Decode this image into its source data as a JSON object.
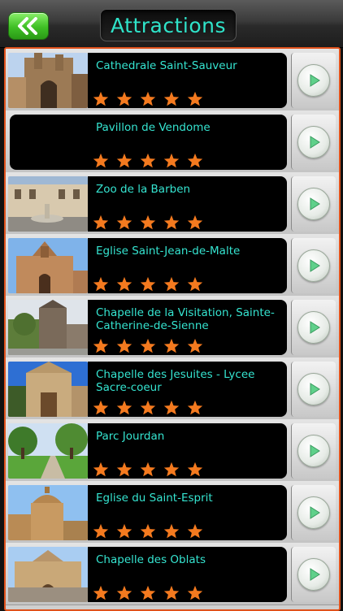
{
  "header": {
    "title": "Attractions",
    "back_icon": "double-chevron-left-icon"
  },
  "colors": {
    "accent_cyan": "#35e4d0",
    "star_orange": "#f47a1f",
    "frame_orange": "#e0521c",
    "back_green": "#3fbf25"
  },
  "attractions": [
    {
      "name": "Cathedrale Saint-Sauveur",
      "rating": 5,
      "has_image": true
    },
    {
      "name": "Pavillon de Vendome",
      "rating": 5,
      "has_image": false
    },
    {
      "name": "Zoo de la Barben",
      "rating": 5,
      "has_image": true
    },
    {
      "name": "Eglise Saint-Jean-de-Malte",
      "rating": 5,
      "has_image": true
    },
    {
      "name": "Chapelle de la Visitation, Sainte-Catherine-de-Sienne",
      "rating": 5,
      "has_image": true
    },
    {
      "name": "Chapelle des Jesuites - Lycee Sacre-coeur",
      "rating": 5,
      "has_image": true
    },
    {
      "name": "Parc Jourdan",
      "rating": 5,
      "has_image": true
    },
    {
      "name": "Eglise du Saint-Esprit",
      "rating": 5,
      "has_image": true
    },
    {
      "name": "Chapelle des Oblats",
      "rating": 5,
      "has_image": true
    }
  ]
}
